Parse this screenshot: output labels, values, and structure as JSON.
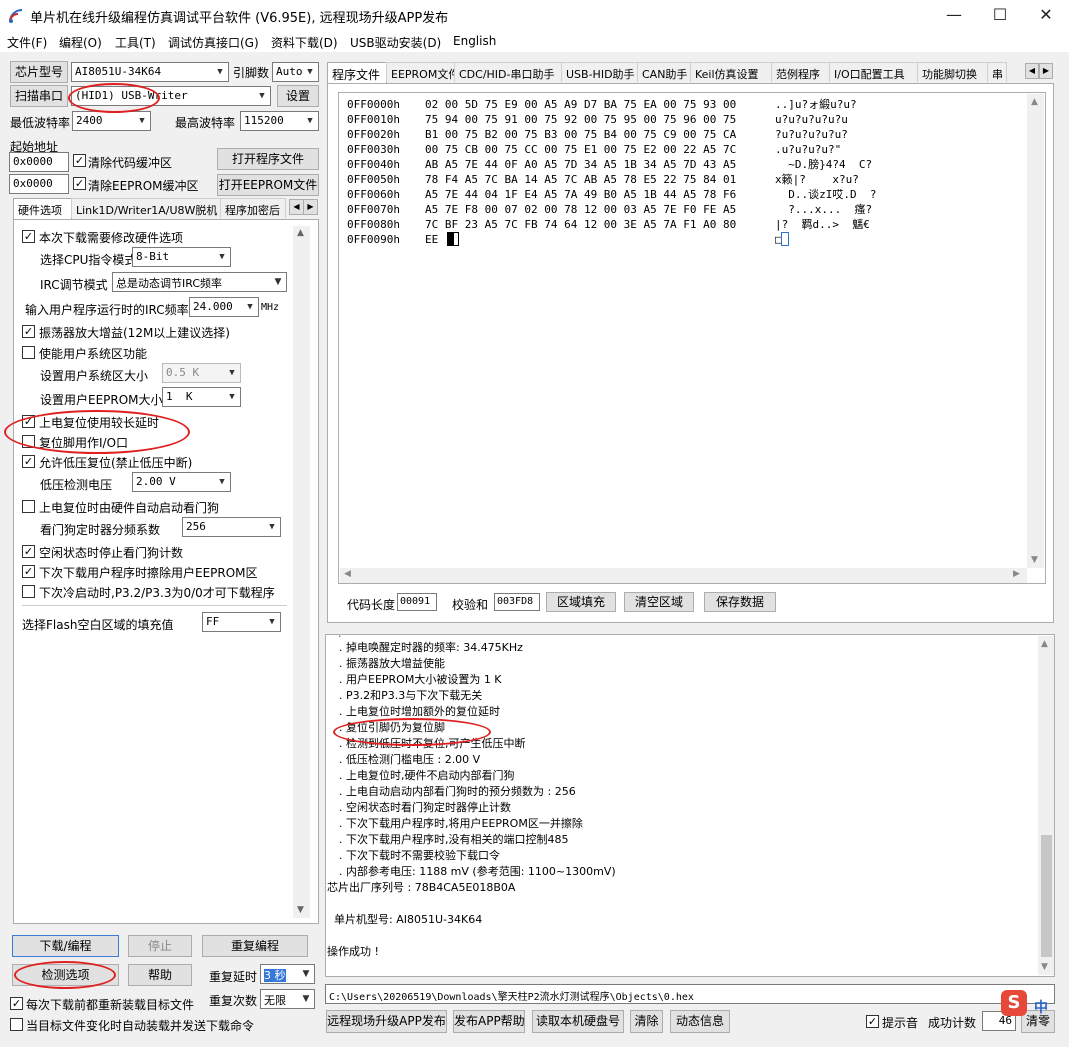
{
  "window": {
    "title": "单片机在线升级编程仿真调试平台软件 (V6.95E), 远程现场升级APP发布",
    "min_icon": "minimize-icon",
    "max_icon": "maximize-icon",
    "close_icon": "close-icon"
  },
  "menu": [
    {
      "label": "文件(F)"
    },
    {
      "label": "编程(O)"
    },
    {
      "label": "工具(T)"
    },
    {
      "label": "调试仿真接口(G)"
    },
    {
      "label": "资料下载(D)"
    },
    {
      "label": "USB驱动安装(D)"
    },
    {
      "label": "English"
    }
  ],
  "left": {
    "chip_model_btn": "芯片型号",
    "chip_model_value": "AI8051U-34K64",
    "pin_count_label": "引脚数",
    "pin_count_value": "Auto",
    "scan_port_btn": "扫描串口",
    "port_value": "(HID1) USB-Writer",
    "settings_btn": "设置",
    "min_baud_label": "最低波特率",
    "min_baud_value": "2400",
    "max_baud_label": "最高波特率",
    "max_baud_value": "115200",
    "start_addr_label": "起始地址",
    "code_addr": "0x0000",
    "clear_code_buffer": "清除代码缓冲区",
    "open_program_btn": "打开程序文件",
    "eeprom_addr": "0x0000",
    "clear_eeprom_buffer": "清除EEPROM缓冲区",
    "open_eeprom_btn": "打开EEPROM文件",
    "tabs": [
      "硬件选项",
      "Link1D/Writer1A/U8W脱机",
      "程序加密后"
    ],
    "hw": {
      "modify_hw": "本次下载需要修改硬件选项",
      "cpu_mode_label": "选择CPU指令模式",
      "cpu_mode_value": "8-Bit",
      "irc_mode_label": "IRC调节模式",
      "irc_mode_value": "总是动态调节IRC频率",
      "irc_freq_label": "输入用户程序运行时的IRC频率",
      "irc_freq_value": "24.000",
      "irc_unit": "MHz",
      "osc_gain": "振荡器放大增益(12M以上建议选择)",
      "sys_area": "使能用户系统区功能",
      "sys_area_size_label": "设置用户系统区大小",
      "sys_area_size_value": "0.5 K",
      "eeprom_size_label": "设置用户EEPROM大小",
      "eeprom_size_value": "1  K",
      "por_delay": "上电复位使用较长延时",
      "reset_io": "复位脚用作I/O口",
      "lvd_reset": "允许低压复位(禁止低压中断)",
      "lvd_voltage_label": "低压检测电压",
      "lvd_voltage_value": "2.00 V",
      "wdt_auto": "上电复位时由硬件自动启动看门狗",
      "wdt_div_label": "看门狗定时器分频系数",
      "wdt_div_value": "256",
      "idle_wdt": "空闲状态时停止看门狗计数",
      "erase_eeprom": "下次下载用户程序时擦除用户EEPROM区",
      "p32_p33": "下次冷启动时,P3.2/P3.3为0/0才可下载程序",
      "flash_fill_label": "选择Flash空白区域的填充值",
      "flash_fill_value": "FF"
    },
    "download_btn": "下载/编程",
    "stop_btn": "停止",
    "reprogram_btn": "重复编程",
    "check_btn": "检测选项",
    "help_btn": "帮助",
    "repeat_delay_label": "重复延时",
    "repeat_delay_value": "3 秒",
    "repeat_count_label": "重复次数",
    "repeat_count_value": "无限",
    "reload_before": "每次下载前都重新装载目标文件",
    "auto_download": "当目标文件变化时自动装载并发送下载命令"
  },
  "right": {
    "tabs": [
      "程序文件",
      "EEPROM文件",
      "CDC/HID-串口助手",
      "USB-HID助手",
      "CAN助手",
      "Keil仿真设置",
      "范例程序",
      "I/O口配置工具",
      "功能脚切换",
      "串"
    ],
    "hex": [
      {
        "addr": "0FF0000h",
        "bytes": "02 00 5D 75 E9 00 A5 A9 D7 BA 75 EA 00 75 93 00",
        "ascii": "..]u?ォ緞u?u?"
      },
      {
        "addr": "0FF0010h",
        "bytes": "75 94 00 75 91 00 75 92 00 75 95 00 75 96 00 75",
        "ascii": "u?u?u?u?u?u"
      },
      {
        "addr": "0FF0020h",
        "bytes": "B1 00 75 B2 00 75 B3 00 75 B4 00 75 C9 00 75 CA",
        "ascii": "?u?u?u?u?u?"
      },
      {
        "addr": "0FF0030h",
        "bytes": "00 75 CB 00 75 CC 00 75 E1 00 75 E2 00 22 A5 7C",
        "ascii": ".u?u?u?u?\""
      },
      {
        "addr": "0FF0040h",
        "bytes": "AB A5 7E 44 0F A0 A5 7D 34 A5 1B 34 A5 7D 43 A5",
        "ascii": "  ~D.膀}4?4  C?"
      },
      {
        "addr": "0FF0050h",
        "bytes": "78 F4 A5 7C BA 14 A5 7C AB A5 78 E5 22 75 84 01",
        "ascii": "x籁|?    x?u?"
      },
      {
        "addr": "0FF0060h",
        "bytes": "A5 7E 44 04 1F E4 A5 7A 49 B0 A5 1B 44 A5 78 F6",
        "ascii": "  D..谈zI哎.D  ?"
      },
      {
        "addr": "0FF0070h",
        "bytes": "A5 7E F8 00 07 02 00 78 12 00 03 A5 7E F0 FE A5",
        "ascii": "  ?...x...  瘙?"
      },
      {
        "addr": "0FF0080h",
        "bytes": "7C BF 23 A5 7C FB 74 64 12 00 3E A5 7A F1 A0 80",
        "ascii": "|?  羁d..>  魑€"
      },
      {
        "addr": "0FF0090h",
        "bytes": "EE",
        "ascii": "□"
      }
    ],
    "code_len_label": "代码长度",
    "code_len_value": "00091",
    "checksum_label": "校验和",
    "checksum_value": "003FD8",
    "fill_btn": "区域填充",
    "clear_btn": "清空区域",
    "save_btn": "保存数据",
    "log": [
      ". 掉电唤醒定时器的频率: 34.475KHz",
      ". 振荡器放大增益使能",
      ". 用户EEPROM大小被设置为 1 K",
      ". P3.2和P3.3与下次下载无关",
      ". 上电复位时增加额外的复位延时",
      ". 复位引脚仍为复位脚",
      ". 检测到低压时不复位,可产生低压中断",
      ". 低压检测门槛电压 : 2.00 V",
      ". 上电复位时,硬件不启动内部看门狗",
      ". 上电自动启动内部看门狗时的预分频数为 : 256",
      ". 空闲状态时看门狗定时器停止计数",
      ". 下次下载用户程序时,将用户EEPROM区一并擦除",
      ". 下次下载用户程序时,没有相关的端口控制485",
      ". 下次下载时不需要校验下载口令",
      ". 内部参考电压: 1188 mV (参考范围: 1100~1300mV)"
    ],
    "serial_line": "芯片出厂序列号 : 78B4CA5E018B0A",
    "chip_line": "  单片机型号: AI8051U-34K64",
    "success_line": "操作成功 !",
    "path": "C:\\Users\\20206519\\Downloads\\擎天柱P2流水灯测试程序\\Objects\\0.hex",
    "publish_btn": "远程现场升级APP发布",
    "publish_help_btn": "发布APP帮助",
    "read_disk_btn": "读取本机硬盘号",
    "clear_btn2": "清除",
    "dynamic_btn": "动态信息",
    "beep_label": "提示音",
    "success_count_label": "成功计数",
    "success_count_value": "46",
    "clear_count_btn": "清零",
    "ime_label": "中"
  }
}
